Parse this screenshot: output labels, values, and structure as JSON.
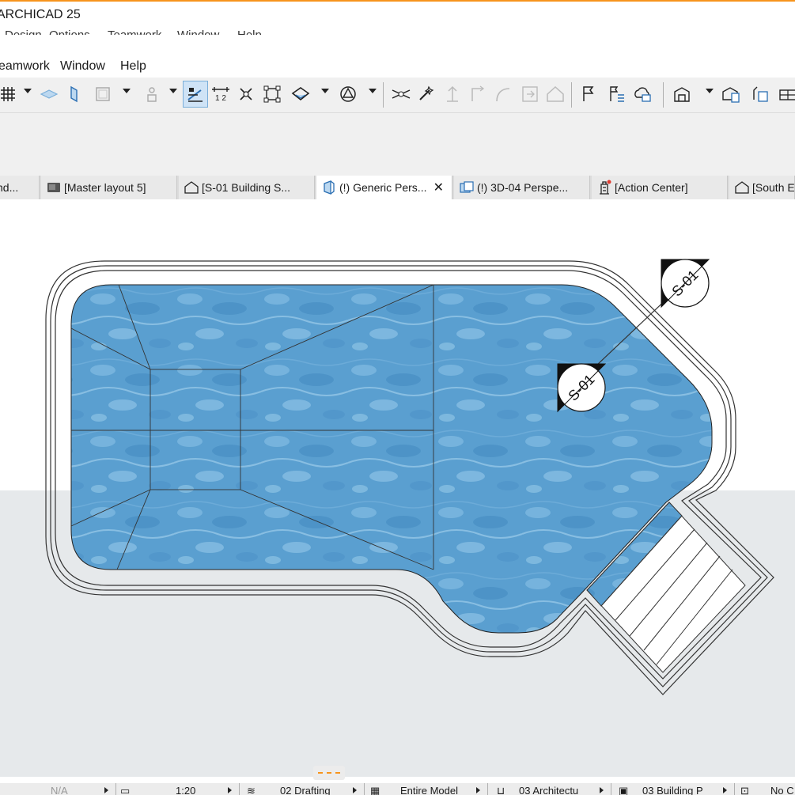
{
  "app": {
    "title": "ARCHICAD 25"
  },
  "menu": {
    "clipped_items": [
      "Design",
      "Options",
      "Teamwork",
      "Window",
      "Help"
    ],
    "items": [
      "eamwork",
      "Window",
      "Help"
    ]
  },
  "toolbar": {
    "icons": [
      "grid-snap-icon",
      "slab-icon",
      "wall-icon",
      "window-icon",
      "figure-icon",
      "guide-line-icon",
      "dimension-icon",
      "cross-icon",
      "group-icon",
      "trace-icon",
      "shape-icon",
      "split-icon",
      "magic-wand-icon",
      "elevate-icon",
      "corner-icon",
      "curve-icon",
      "offset-icon",
      "roof-icon",
      "flag-icon",
      "marker-list-icon",
      "cloud-icon",
      "layout-icon",
      "publish-icon",
      "update-icon",
      "table-icon"
    ],
    "active": "guide-line-icon"
  },
  "tabs": [
    {
      "label": "nd...",
      "icon": "",
      "active": false
    },
    {
      "label": "[Master layout 5]",
      "icon": "layout-tab-icon",
      "active": false
    },
    {
      "label": "[S-01 Building S...",
      "icon": "house-tab-icon",
      "active": false
    },
    {
      "label": "(!) Generic Pers...",
      "icon": "perspective-tab-icon",
      "active": true,
      "close": "✕"
    },
    {
      "label": "(!) 3D-04 Perspe...",
      "icon": "camera-tab-icon",
      "active": false
    },
    {
      "label": "[Action Center]",
      "icon": "action-center-tab-icon",
      "active": false
    },
    {
      "label": "[South E",
      "icon": "house-tab-icon",
      "active": false
    }
  ],
  "markers": [
    {
      "text": "S-01"
    },
    {
      "text": "S-01"
    }
  ],
  "status": {
    "items": [
      "N/A",
      "1:20",
      "02 Drafting",
      "Entire Model",
      "03 Architectu",
      "03 Building P",
      "No C"
    ]
  },
  "colors": {
    "accent": "#f7941d",
    "water": "#5a9fd0",
    "active_tab": "#ffffff"
  }
}
